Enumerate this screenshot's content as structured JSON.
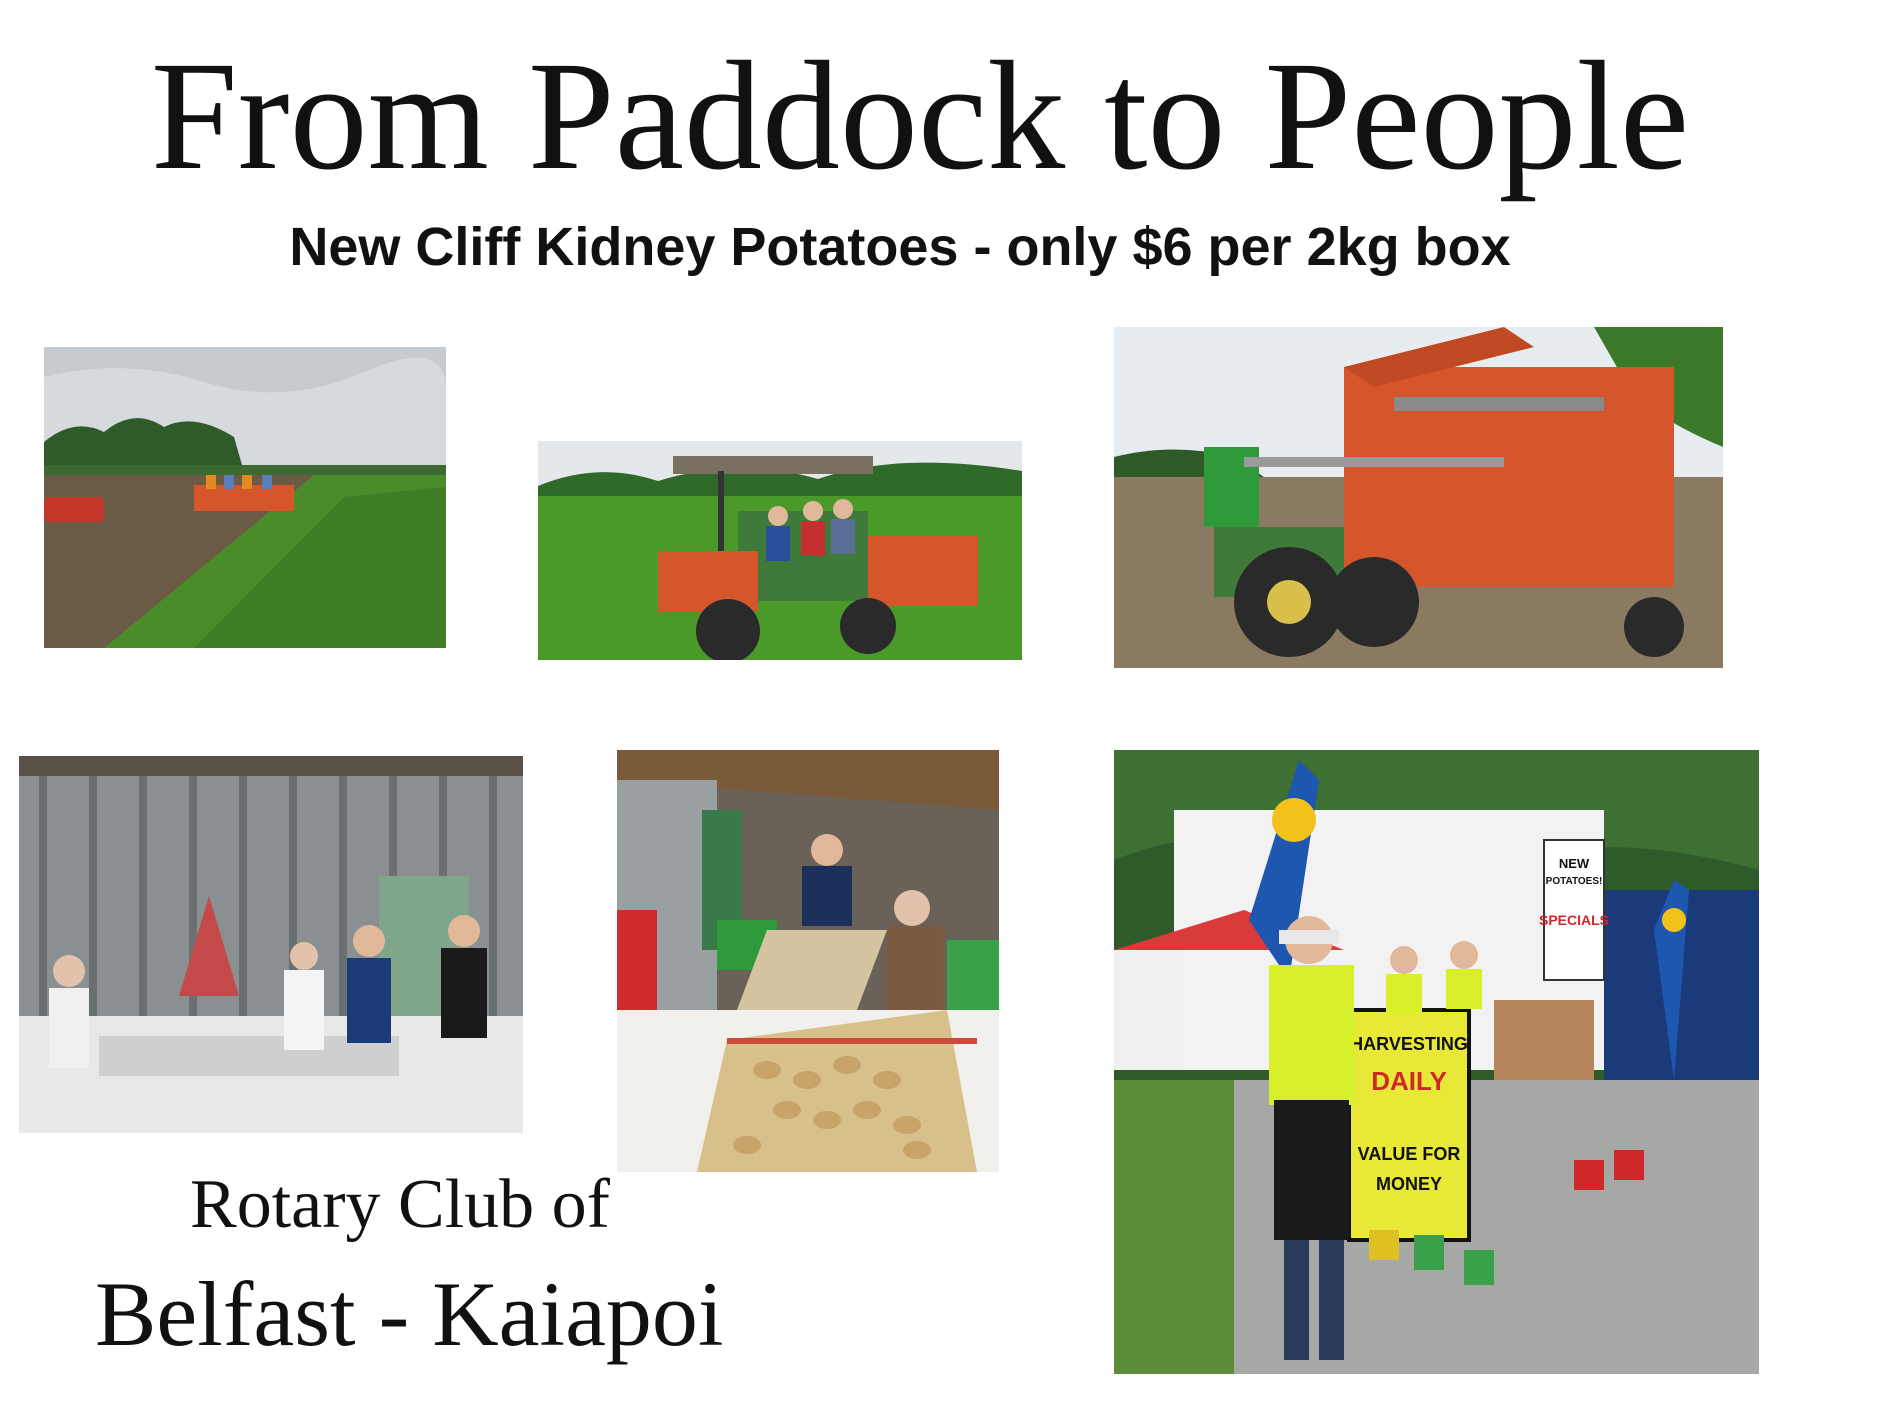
{
  "header": {
    "title": "From Paddock to People",
    "subtitle": "New Cliff Kidney Potatoes - only $6 per 2kg box"
  },
  "footer": {
    "club_line1": "Rotary Club of",
    "club_line2": "Belfast - Kaiapoi"
  },
  "stall_signs": {
    "sign1_line1": "NEW",
    "sign1_line2": "POTATOES!",
    "sign1_line3": "SPECIALS",
    "board_line1": "HARVESTING",
    "board_line2": "DAILY",
    "board_line3": "VALUE FOR",
    "board_line4": "MONEY"
  },
  "colors": {
    "sky": "#dfe4e6",
    "field_green": "#4a8c2a",
    "soil": "#6b5a45",
    "harvester_orange": "#d4562a",
    "tractor_green": "#3f7a3a",
    "shed_grey": "#7a7f80",
    "hi_vis": "#d8f02a",
    "rotary_blue": "#1d57b0",
    "rotary_gold": "#f2c21a"
  }
}
